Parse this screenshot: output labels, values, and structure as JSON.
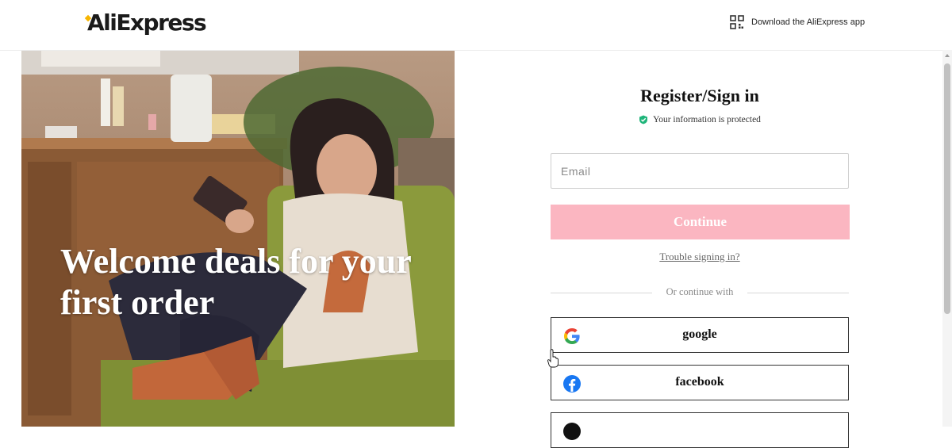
{
  "header": {
    "logo": "AliExpress",
    "download_app": "Download the AliExpress app"
  },
  "hero": {
    "headline": "Welcome deals for your first order"
  },
  "form": {
    "title": "Register/Sign in",
    "protected_text": "Your information is protected",
    "email_placeholder": "Email",
    "email_value": "",
    "continue_label": "Continue",
    "trouble_link": "Trouble signing in?",
    "divider_text": "Or continue with"
  },
  "social": [
    {
      "label": "google",
      "icon": "google-icon"
    },
    {
      "label": "facebook",
      "icon": "facebook-icon"
    },
    {
      "label": "",
      "icon": "apple-icon"
    }
  ],
  "colors": {
    "continue_disabled": "#fbb6c1",
    "protected_check": "#1fb57a",
    "facebook_blue": "#1877f2"
  }
}
